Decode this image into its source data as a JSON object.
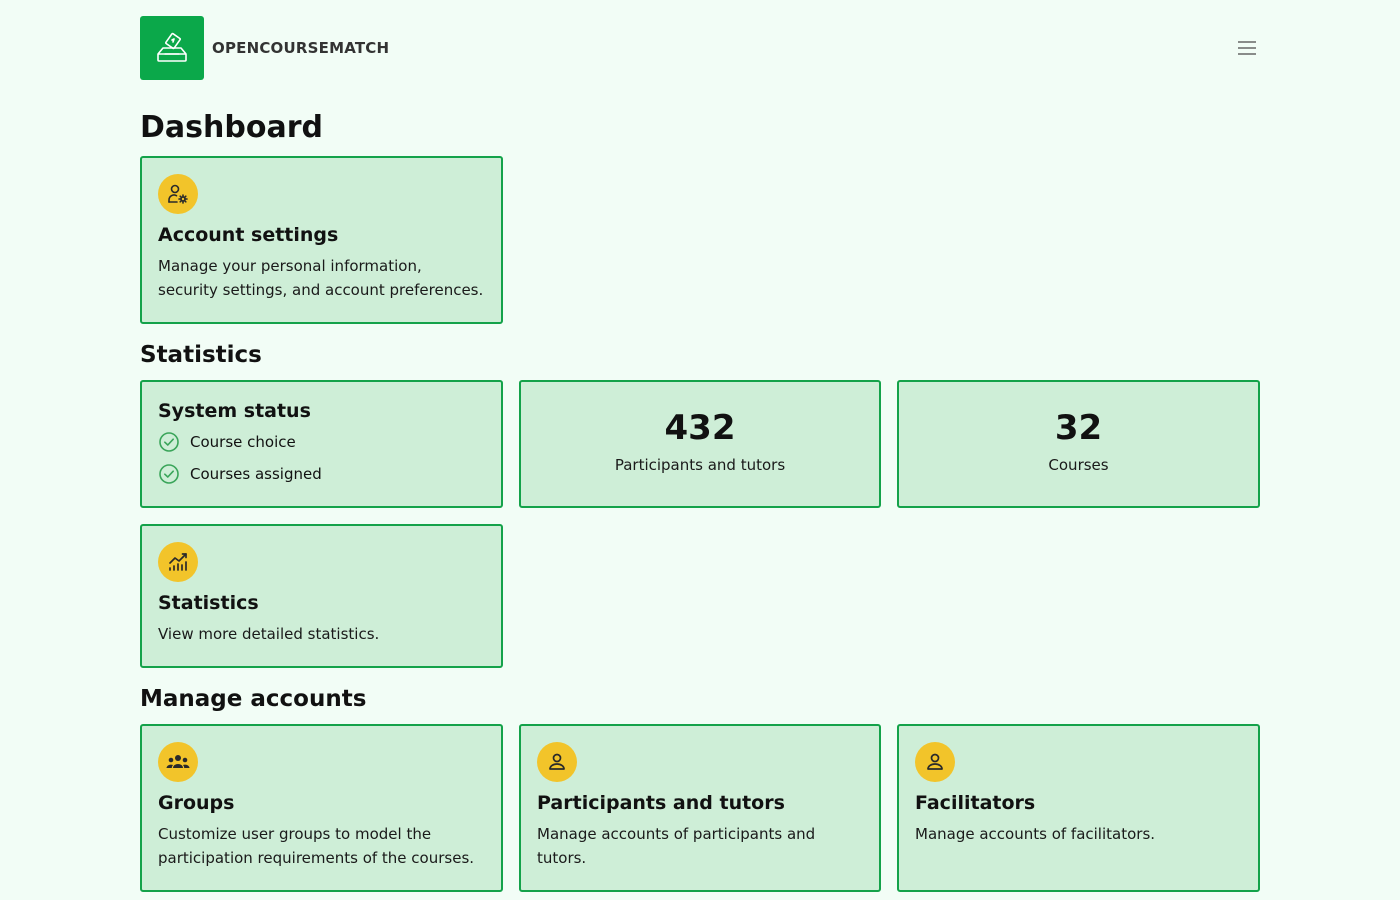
{
  "app": {
    "brand_name": "OPENCOURSEMATCH",
    "logo_icon": "ballot-box-icon",
    "menu_icon": "hamburger-menu-icon"
  },
  "page": {
    "title": "Dashboard"
  },
  "account_settings": {
    "icon": "user-gear-icon",
    "title": "Account settings",
    "description": "Manage your personal information, security settings, and account preferences."
  },
  "statistics_section": {
    "title": "Statistics",
    "system_status": {
      "title": "System status",
      "items": [
        {
          "label": "Course choice",
          "icon": "check-circle-icon"
        },
        {
          "label": "Courses assigned",
          "icon": "check-circle-icon"
        }
      ]
    },
    "participants": {
      "value": "432",
      "label": "Participants and tutors"
    },
    "courses": {
      "value": "32",
      "label": "Courses"
    },
    "details": {
      "icon": "chart-icon",
      "title": "Statistics",
      "description": "View more detailed statistics."
    }
  },
  "manage_accounts": {
    "title": "Manage accounts",
    "groups": {
      "icon": "users-group-icon",
      "title": "Groups",
      "description": "Customize user groups to model the participation requirements of the courses."
    },
    "participants_tutors": {
      "icon": "user-icon",
      "title": "Participants and tutors",
      "description": "Manage accounts of participants and tutors."
    },
    "facilitators": {
      "icon": "user-icon",
      "title": "Facilitators",
      "description": "Manage accounts of facilitators."
    }
  },
  "colors": {
    "background": "#f2fdf6",
    "card_bg": "#ceeed7",
    "card_border": "#14a24a",
    "brand_green": "#0ba84a",
    "icon_yellow": "#f2c42a",
    "check_green": "#3aa55a"
  }
}
